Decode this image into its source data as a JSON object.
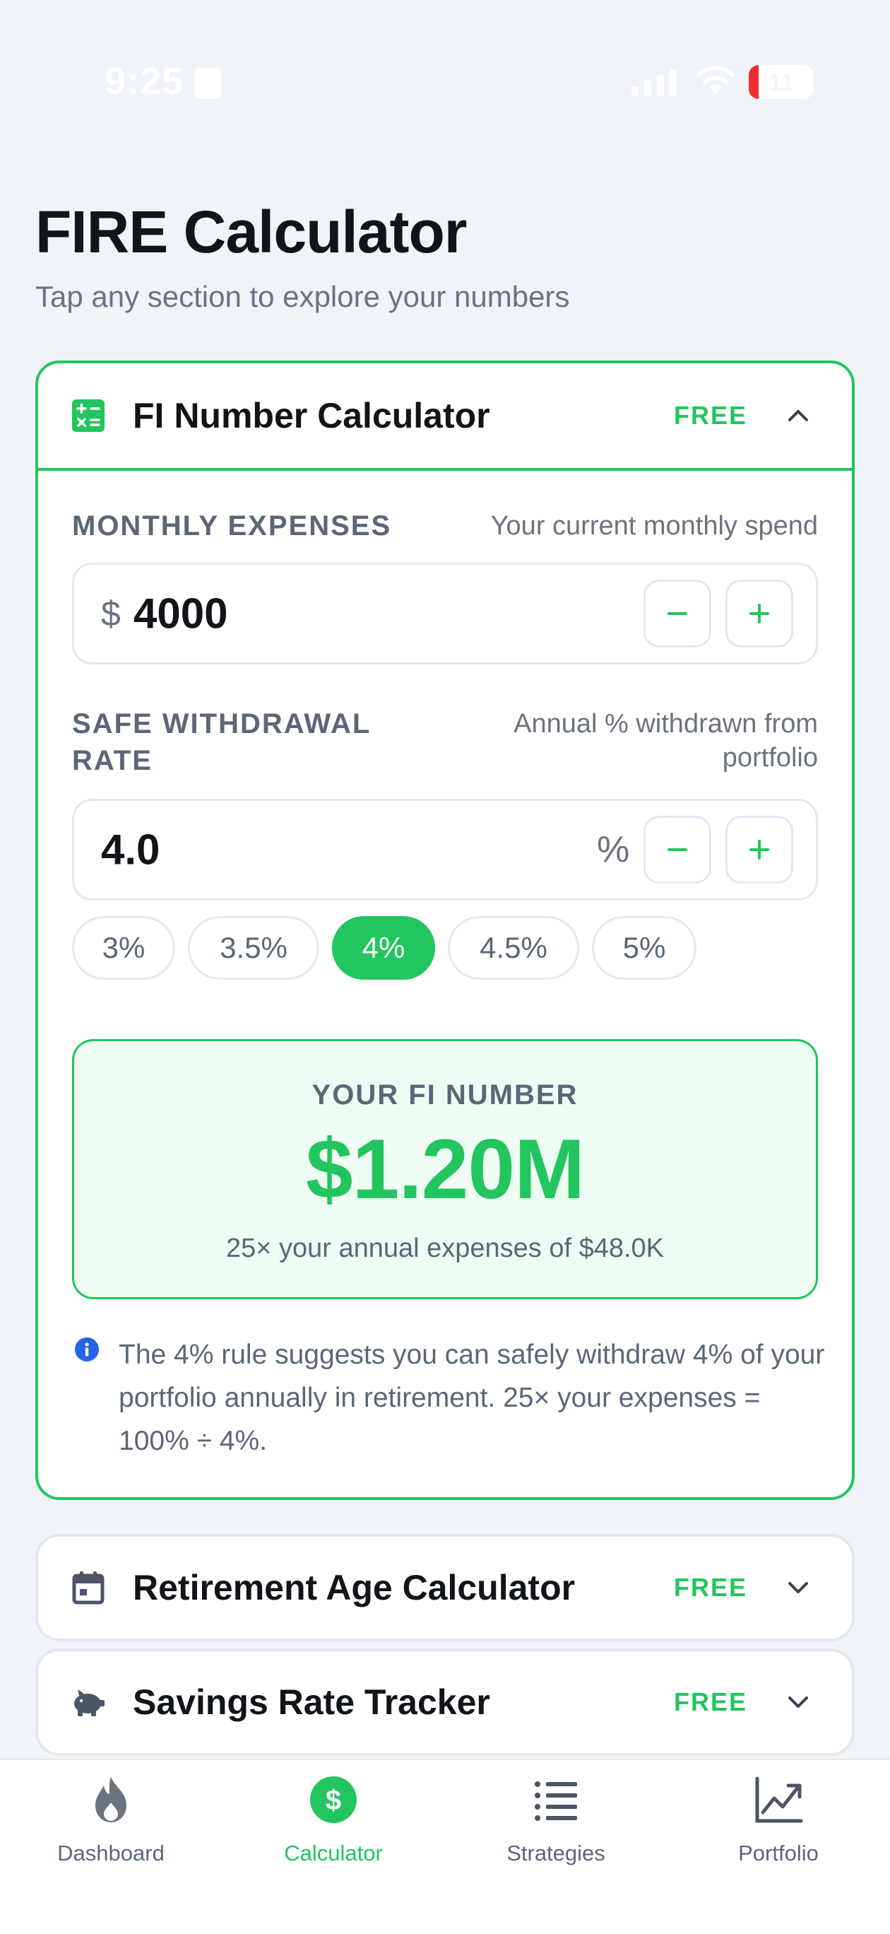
{
  "status_bar": {
    "time": "9:25",
    "battery": "11"
  },
  "header": {
    "title": "FIRE Calculator",
    "subtitle": "Tap any section to explore your numbers"
  },
  "sections": [
    {
      "title": "FI Number Calculator",
      "badge": "FREE",
      "icon": "calculator-icon",
      "expanded": true
    },
    {
      "title": "Retirement Age Calculator",
      "badge": "FREE",
      "icon": "calendar-icon",
      "expanded": false
    },
    {
      "title": "Savings Rate Tracker",
      "badge": "FREE",
      "icon": "piggy-bank-icon",
      "expanded": false
    }
  ],
  "fi_calculator": {
    "monthly_expenses": {
      "label": "MONTHLY EXPENSES",
      "hint": "Your current monthly spend",
      "prefix": "$",
      "value": "4000"
    },
    "withdrawal_rate": {
      "label_line1": "SAFE WITHDRAWAL",
      "label_line2": "RATE",
      "hint_line1": "Annual % withdrawn from",
      "hint_line2": "portfolio",
      "value": "4.0",
      "suffix": "%"
    },
    "presets": [
      {
        "label": "3%",
        "active": false
      },
      {
        "label": "3.5%",
        "active": false
      },
      {
        "label": "4%",
        "active": true
      },
      {
        "label": "4.5%",
        "active": false
      },
      {
        "label": "5%",
        "active": false
      }
    ],
    "result": {
      "label": "YOUR FI NUMBER",
      "value": "$1.20M",
      "note": "25× your annual expenses of $48.0K"
    },
    "info": "The 4% rule suggests you can safely withdraw 4% of your portfolio annually in retirement. 25× your expenses = 100% ÷ 4%."
  },
  "colors": {
    "accent": "#22c55e",
    "background": "#f0f3f8",
    "muted_text": "#5b6678",
    "info": "#2563eb"
  },
  "bottom_nav": [
    {
      "label": "Dashboard",
      "icon": "flame-icon",
      "active": false
    },
    {
      "label": "Calculator",
      "icon": "dollar-icon",
      "active": true
    },
    {
      "label": "Strategies",
      "icon": "list-icon",
      "active": false
    },
    {
      "label": "Portfolio",
      "icon": "chart-line-icon",
      "active": false
    }
  ]
}
